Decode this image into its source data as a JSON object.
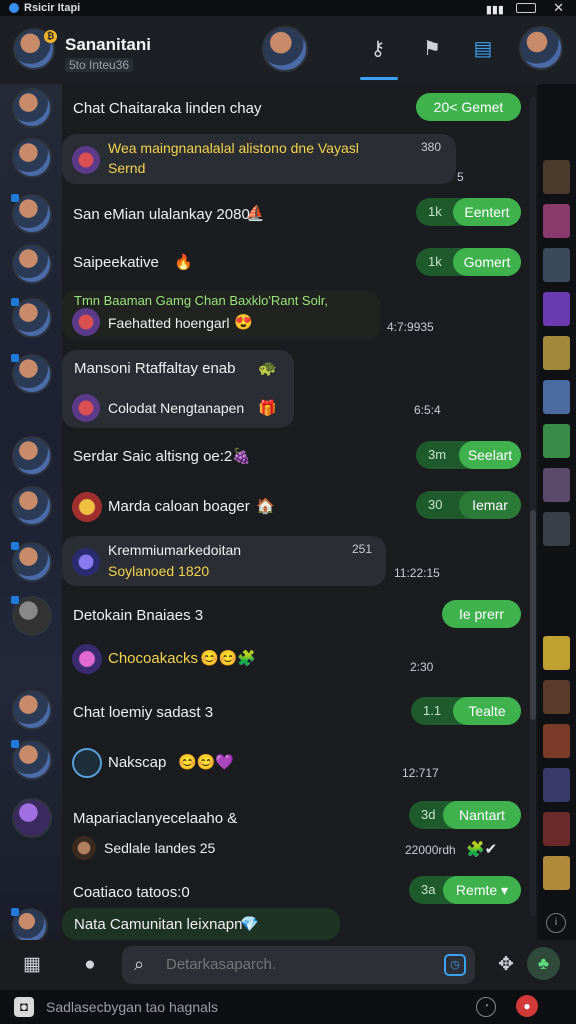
{
  "statusbar": {
    "app_name": "Rsicir Itapi",
    "close": "✕"
  },
  "header": {
    "title": "Sananitani",
    "subtitle": "5to Inteu36",
    "badge": "₿",
    "icons": [
      "key-icon",
      "flag-icon",
      "chat-icon"
    ]
  },
  "messages": [
    {
      "text": "Chat Chaitaraka linden chay",
      "time": "",
      "pill_num": "20<",
      "pill_btn": "Gemet"
    },
    {
      "text": "Wea maingnanalalal alistono dne Vayasl",
      "text2": "Sernd",
      "time": "380",
      "time2": "5"
    },
    {
      "text": "San eMian ulalankay 2080",
      "pill_num": "1k",
      "pill_btn": "Eentert"
    },
    {
      "text": "Saipeekative",
      "pill_num": "1k",
      "pill_btn": "Gomert"
    },
    {
      "text": "Tmn Baaman Gamg Chan Baxklo'Rant Solr,",
      "text2": "Faehatted hoengarl",
      "time": "4:7:9935"
    },
    {
      "text": "Mansoni Rtaffaltay enab",
      "text2": "Colodat Nengtanapen",
      "time": "6:5:4"
    },
    {
      "text": "Serdar Saic altisng oe:2",
      "pill_num": "3m",
      "pill_btn": "Seelart"
    },
    {
      "text": "Marda caloan boager",
      "pill_num": "30",
      "pill_btn": "Iemar"
    },
    {
      "text": "Kremmiumarkedoitan",
      "text2": "Soylanoed 1820",
      "time": "251",
      "time2": "11:22:15"
    },
    {
      "text": "Detokain Bnaiaes 3",
      "pill_btn": "Ie prerr"
    },
    {
      "text": "Chocoakacks",
      "time": "2:30"
    },
    {
      "text": "Chat loemiy sadast 3",
      "pill_num": "1.1",
      "pill_btn": "Tealte"
    },
    {
      "text": "Nakscap",
      "time": "12:717"
    },
    {
      "text": "Mapariaclanyecelaaho &",
      "text2": "Sedlale landes 25",
      "time2": "22000rdh",
      "pill_num": "3d",
      "pill_btn": "Nantart"
    },
    {
      "text": "Coatiaco tatoos:0",
      "pill_num": "3a",
      "pill_btn": "Remte ▾"
    },
    {
      "text": "Nata Camunitan leixnapn"
    }
  ],
  "composer": {
    "placeholder": "Detarkasaparch."
  },
  "footer": {
    "text": "Sadlasecbygan tao hagnals"
  },
  "colors": {
    "accent": "#3aa0f0",
    "green": "#3fb24e",
    "yellow": "#f2d44a"
  }
}
